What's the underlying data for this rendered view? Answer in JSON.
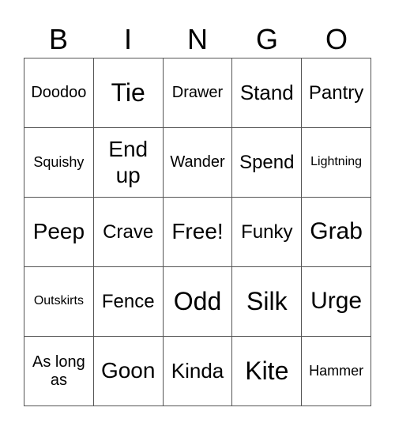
{
  "header": [
    "B",
    "I",
    "N",
    "G",
    "O"
  ],
  "cells": [
    [
      "Doodoo",
      "Tie",
      "Drawer",
      "Stand",
      "Pantry"
    ],
    [
      "Squishy",
      "End up",
      "Wander",
      "Spend",
      "Lightning"
    ],
    [
      "Peep",
      "Crave",
      "Free!",
      "Funky",
      "Grab"
    ],
    [
      "Outskirts",
      "Fence",
      "Odd",
      "Silk",
      "Urge"
    ],
    [
      "As long as",
      "Goon",
      "Kinda",
      "Kite",
      "Hammer"
    ]
  ]
}
